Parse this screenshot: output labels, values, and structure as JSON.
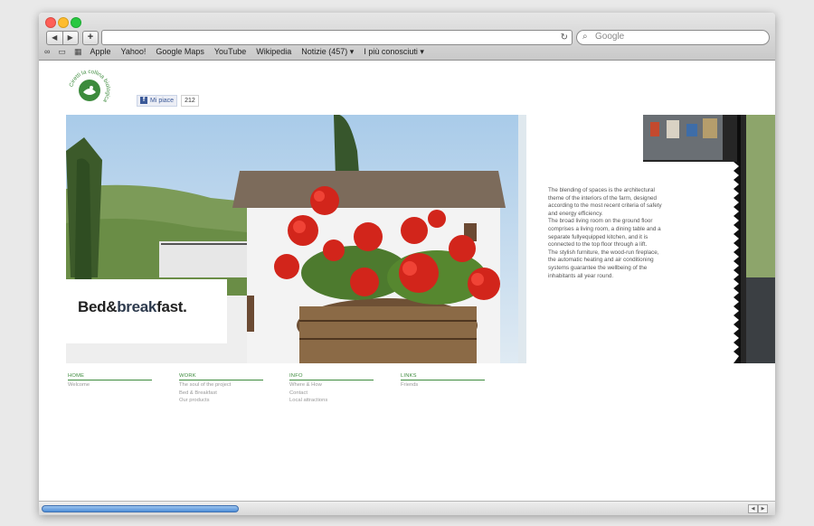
{
  "browser": {
    "back_label": "◀",
    "forward_label": "▶",
    "add_label": "+",
    "reload_icon": "reload-icon",
    "search_placeholder": "Google",
    "bookmarks": [
      "Apple",
      "Yahoo!",
      "Google Maps",
      "YouTube",
      "Wikipedia",
      "Notizie (457) ▾",
      "I più conosciuti ▾"
    ]
  },
  "page": {
    "logo_text": "Ciretti la collina biologica",
    "fb_like_label": "Mi piace",
    "fb_like_count": "212",
    "bb_part1": "Bed&",
    "bb_part2": "break",
    "bb_part3": "fast.",
    "panel_text": "The blending of spaces is the architectural theme of the interiors of the farm, designed according to the most recent criteria of safety and energy efficiency.\nThe broad living room on the ground floor comprises a living room, a dining table and a separate fullyequipped kitchen, and it is connected to the top floor through a lift.\nThe stylish furniture, the wood-run fireplace, the automatic heating and air conditioning systems guarantee the wellbeing of the inhabitants all year round.",
    "footer": [
      {
        "heading": "HOME",
        "items": [
          "Welcome"
        ]
      },
      {
        "heading": "WORK",
        "items": [
          "The soul of the project",
          "Bed & Breakfast",
          "Our products"
        ]
      },
      {
        "heading": "INFO",
        "items": [
          "Where & How",
          "Contact",
          "Local attractions"
        ]
      },
      {
        "heading": "LINKS",
        "items": [
          "Friends"
        ]
      }
    ]
  },
  "colors": {
    "accent_green": "#3d8b3d",
    "fb_blue": "#3b5998"
  }
}
